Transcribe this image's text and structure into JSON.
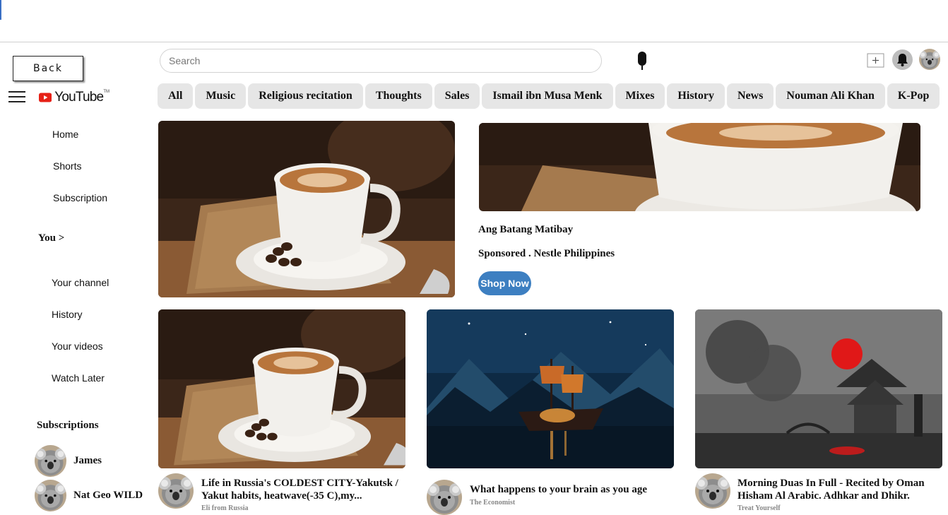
{
  "header": {
    "back_label": "Back",
    "search_placeholder": "Search",
    "logo_text": "YouTube",
    "logo_tm": "TM"
  },
  "chips": [
    "All",
    "Music",
    "Religious recitation",
    "Thoughts",
    "Sales",
    "Ismail ibn Musa Menk",
    "Mixes",
    "History",
    "News",
    "Nouman Ali Khan",
    "K-Pop"
  ],
  "sidebar": {
    "main": [
      "Home",
      "Shorts",
      "Subscription"
    ],
    "you_label": "You >",
    "you_items": [
      "Your channel",
      "History",
      "Your videos",
      "Watch Later"
    ],
    "subscriptions_label": "Subscriptions",
    "subscriptions": [
      "James",
      "Nat Geo WILD"
    ]
  },
  "ad": {
    "title": "Ang Batang Matibay",
    "sponsor": "Sponsored . Nestle Philippines",
    "button": "Shop Now"
  },
  "videos": [
    {
      "title_line1": "Life in Russia's COLDEST CITY-Yakutsk /",
      "title_line2": "Yakut habits, heatwave(-35 C),my...",
      "channel": "Eli from Russia"
    },
    {
      "title_line1": "What happens to your brain as you age",
      "title_line2": "",
      "channel": "The Economist"
    },
    {
      "title_line1": "Morning Duas In Full - Recited by Oman",
      "title_line2": "Hisham Al Arabic. Adhkar and Dhikr.",
      "channel": "Treat Yourself"
    }
  ],
  "icons": {
    "mic": "microphone-icon",
    "create": "create-video-icon",
    "bell": "bell-icon",
    "menu": "hamburger-menu-icon"
  },
  "colors": {
    "accent": "#3d7fc1",
    "chip_bg": "#e6e6e6",
    "logo_red": "#e62117"
  }
}
